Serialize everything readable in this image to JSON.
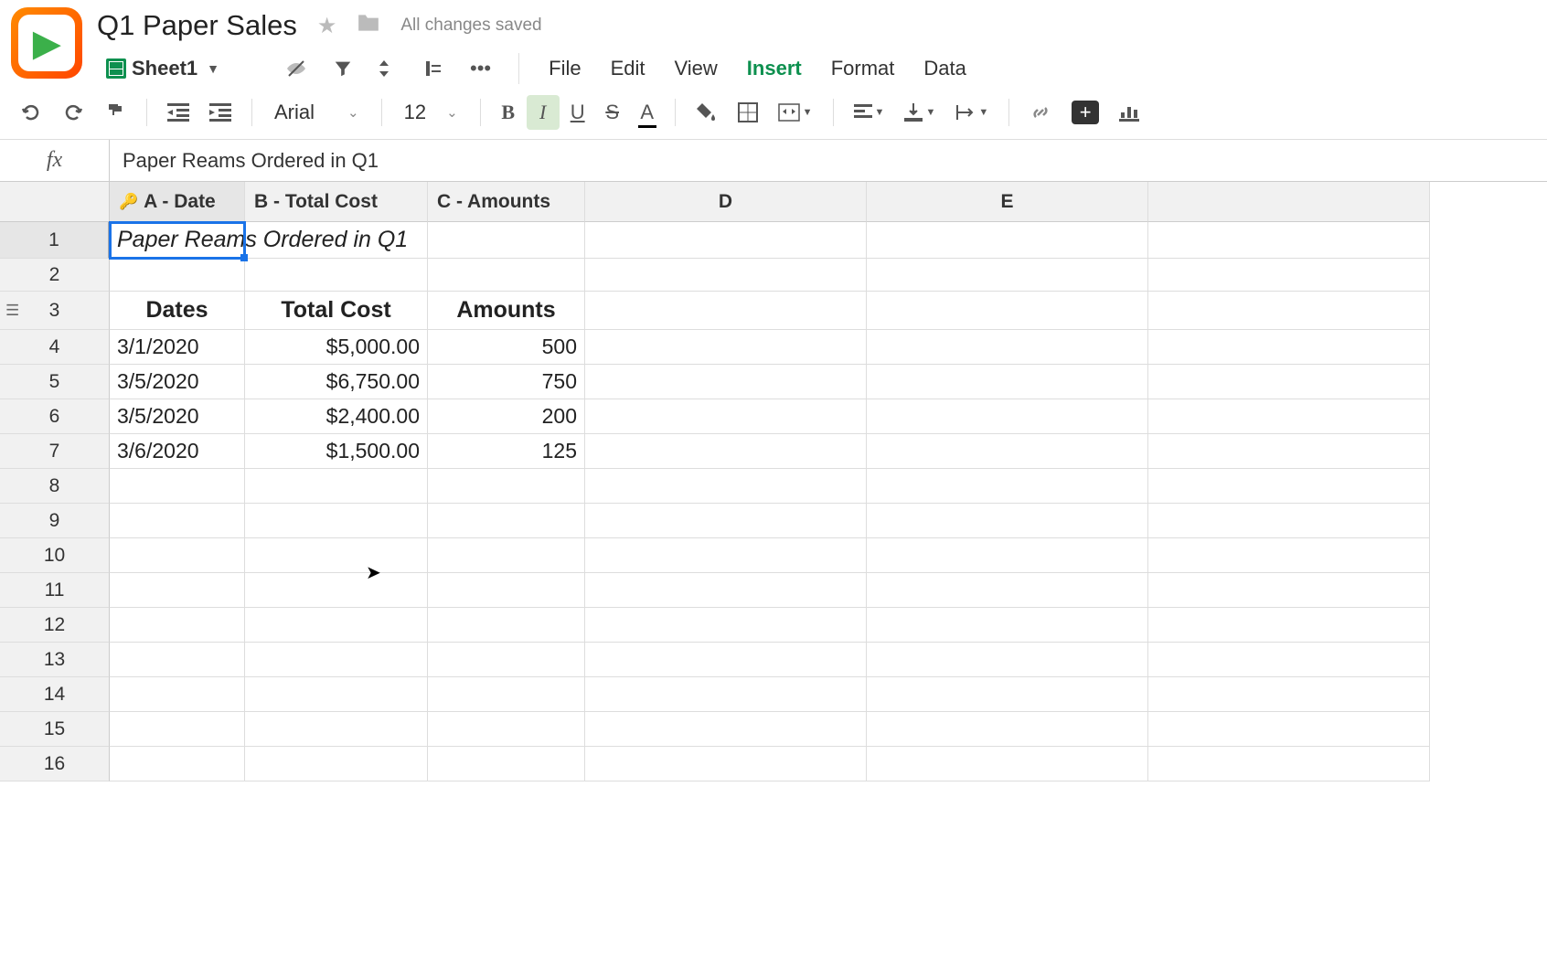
{
  "doc": {
    "title": "Q1 Paper Sales",
    "save_status": "All changes saved",
    "sheet_name": "Sheet1"
  },
  "menu": {
    "file": "File",
    "edit": "Edit",
    "view": "View",
    "insert": "Insert",
    "format": "Format",
    "data": "Data"
  },
  "toolbar": {
    "font_name": "Arial",
    "font_size": "12"
  },
  "formula": {
    "label": "fx",
    "value": "Paper Reams Ordered in Q1"
  },
  "columns": {
    "a": "A - Date",
    "b": "B - Total Cost",
    "c": "C - Amounts",
    "d": "D",
    "e": "E"
  },
  "rows": [
    "1",
    "2",
    "3",
    "4",
    "5",
    "6",
    "7",
    "8",
    "9",
    "10",
    "11",
    "12",
    "13",
    "14",
    "15",
    "16"
  ],
  "cells": {
    "a1": "Paper Reams Ordered in Q1",
    "a3": "Dates",
    "b3": "Total Cost",
    "c3": "Amounts",
    "a4": "3/1/2020",
    "b4": "$5,000.00",
    "c4": "500",
    "a5": "3/5/2020",
    "b5": "$6,750.00",
    "c5": "750",
    "a6": "3/5/2020",
    "b6": "$2,400.00",
    "c6": "200",
    "a7": "3/6/2020",
    "b7": "$1,500.00",
    "c7": "125"
  },
  "icons": {
    "comment_plus": "+"
  }
}
